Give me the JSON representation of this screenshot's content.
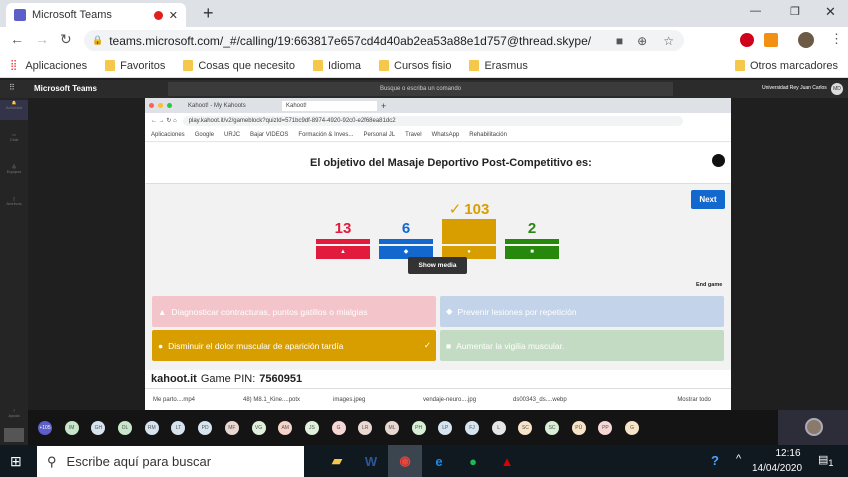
{
  "browser": {
    "tab_title": "Microsoft Teams",
    "url": "teams.microsoft.com/_#/calling/19:663817e657cd4d40ab2ea53a88e1d757@thread.skype/",
    "bookmarks": [
      "Aplicaciones",
      "Favoritos",
      "Cosas que necesito",
      "Idioma",
      "Cursos fisio",
      "Erasmus"
    ],
    "other_bookmarks": "Otros marcadores"
  },
  "teams": {
    "app_name": "Microsoft Teams",
    "search_placeholder": "Busque o escriba un comando",
    "org": "Universidad Rey Juan Carlos",
    "user_initials": "MD",
    "rail": [
      "Actividad",
      "Chat",
      "Equipos",
      "Archivos"
    ],
    "help": "Ayuda"
  },
  "shared": {
    "tabs": [
      "Kahoot! - My Kahoots",
      "Kahoot!"
    ],
    "url": "play.kahoot.it/v2/gameblock?quizId=571bc9df-8974-4920-92c0-e2f68ea81dc2",
    "bookmarks": [
      "Aplicaciones",
      "Google",
      "URJC",
      "Bajar VIDEOS",
      "Formación & Inves...",
      "Personal JL",
      "Travel",
      "WhatsApp",
      "Rehabilitación"
    ],
    "question": "El objetivo del Masaje Deportivo Post-Competitivo es:",
    "next": "Next",
    "show_media": "Show media",
    "end_game": "End game",
    "results": [
      {
        "count": 13,
        "color": "#e21b3c",
        "shape": "triangle",
        "correct": false
      },
      {
        "count": 6,
        "color": "#1368ce",
        "shape": "diamond",
        "correct": false
      },
      {
        "count": 103,
        "color": "#d89e00",
        "shape": "circle",
        "correct": true
      },
      {
        "count": 2,
        "color": "#26890c",
        "shape": "square",
        "correct": false
      }
    ],
    "correct_mark": "✓",
    "answers": [
      "Diagnosticar contracturas, puntos gatillos o mialgias",
      "Prevenir lesiones por repetición",
      "Disminuir el dolor muscular de aparición tardía",
      "Aumentar la vigilia muscular."
    ],
    "brand": "kahoot.it",
    "pin_label": "Game PIN:",
    "pin": "7560951",
    "downloads": [
      "Me parto....mp4",
      "48) M8.1_Kine....potx",
      "images.jpeg",
      "vendaje-neuro....jpg",
      "ds00343_ds....webp"
    ],
    "show_all": "Mostrar todo"
  },
  "participants": [
    "+105",
    "IM",
    "GH",
    "DL",
    "RM",
    "LT",
    "PD",
    "MF",
    "VG",
    "AM",
    "JS",
    "G",
    "LR",
    "ML",
    "PH",
    "LP",
    "FJ",
    "L",
    "SC",
    "SC",
    "PÚ",
    "PP",
    "G"
  ],
  "participant_colors": [
    "#5b5fc7",
    "#c8e6c9",
    "#d6e4f0",
    "#c8e6c9",
    "#d6e4f0",
    "#d6e4f0",
    "#d6e4f0",
    "#ead7d1",
    "#e0f0dc",
    "#f5d3c8",
    "#e0f0dc",
    "#f7d6d6",
    "#ead7d1",
    "#ead7d1",
    "#d7eed7",
    "#d6e4f0",
    "#d6e4f0",
    "#e6e6e6",
    "#f7e4c8",
    "#d7eed7",
    "#f7e4c8",
    "#f7d6d6",
    "#f7e4c8"
  ],
  "taskbar": {
    "search": "Escribe aquí para buscar",
    "time": "12:16",
    "date": "14/04/2020",
    "notifications": "1"
  }
}
